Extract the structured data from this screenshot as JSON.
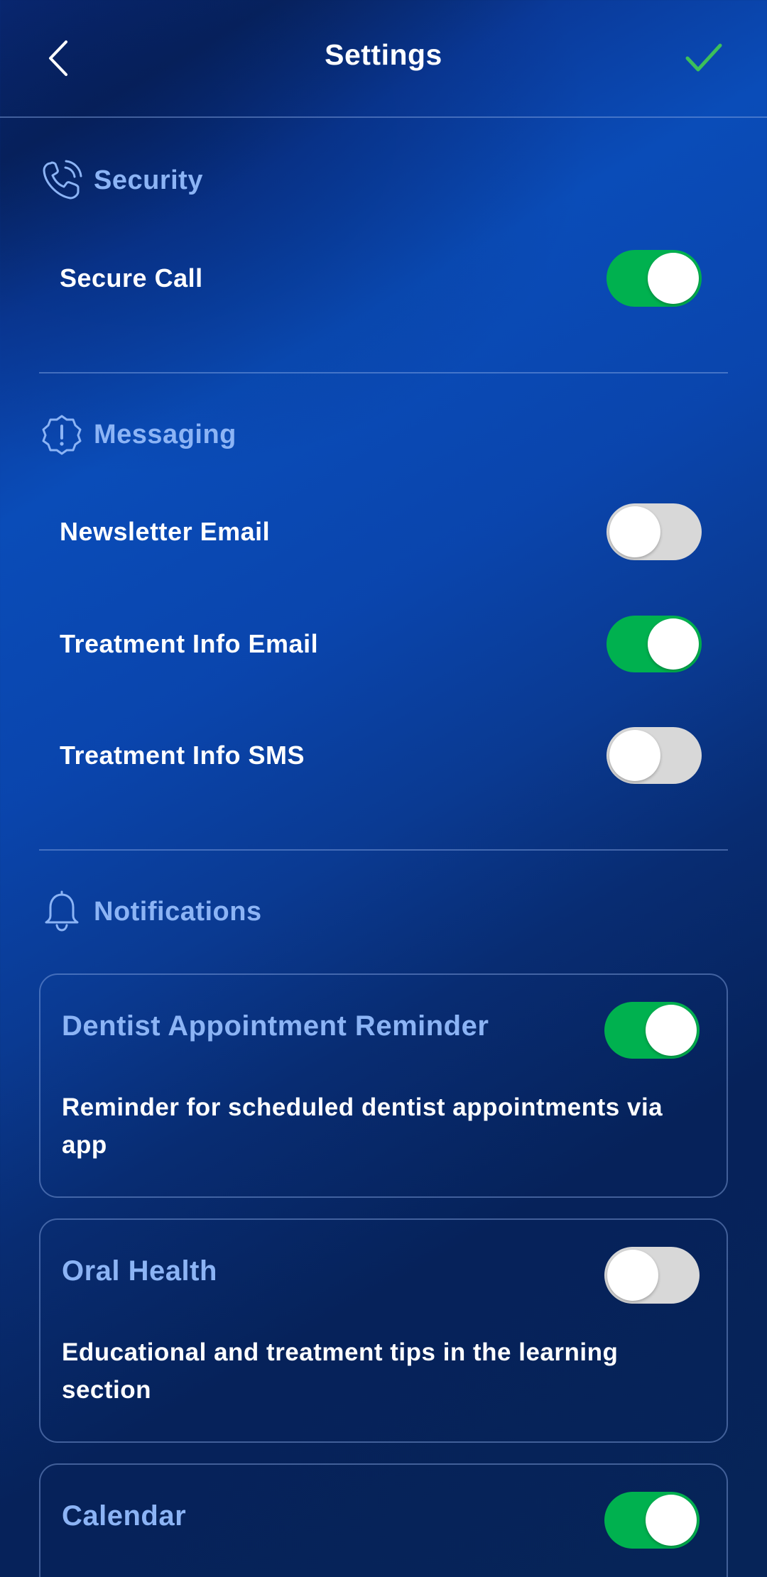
{
  "header": {
    "title": "Settings",
    "back_icon": "chevron-left-icon",
    "confirm_icon": "checkmark-icon",
    "confirm_color": "#3cc05a"
  },
  "colors": {
    "accent": "#8cb4f5",
    "toggle_on": "#00b14f",
    "toggle_off": "#d8d8d8"
  },
  "sections": {
    "security": {
      "title": "Security",
      "icon": "phone-call-icon",
      "items": [
        {
          "label": "Secure Call",
          "enabled": true
        }
      ]
    },
    "messaging": {
      "title": "Messaging",
      "icon": "alert-badge-icon",
      "items": [
        {
          "label": "Newsletter Email",
          "enabled": false
        },
        {
          "label": "Treatment Info Email",
          "enabled": true
        },
        {
          "label": "Treatment Info SMS",
          "enabled": false
        }
      ]
    },
    "notifications": {
      "title": "Notifications",
      "icon": "bell-icon",
      "cards": [
        {
          "title": "Dentist Appointment Reminder",
          "description": "Reminder for scheduled dentist appointments via app",
          "enabled": true
        },
        {
          "title": "Oral Health",
          "description": "Educational and treatment tips in the learning section",
          "enabled": false
        },
        {
          "title": "Calendar",
          "description": "",
          "enabled": true
        }
      ]
    }
  }
}
